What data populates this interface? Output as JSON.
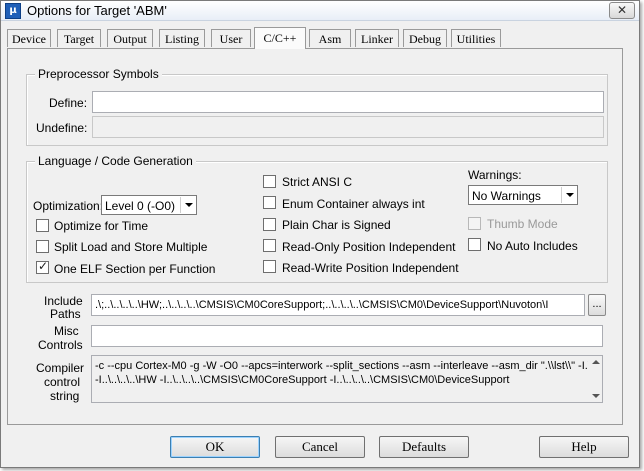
{
  "window": {
    "title": "Options for Target 'ABM'",
    "icon_text": "µ",
    "close_label": "✕"
  },
  "tabs": [
    {
      "label": "Device",
      "active": false
    },
    {
      "label": "Target",
      "active": false
    },
    {
      "label": "Output",
      "active": false
    },
    {
      "label": "Listing",
      "active": false
    },
    {
      "label": "User",
      "active": false
    },
    {
      "label": "C/C++",
      "active": true
    },
    {
      "label": "Asm",
      "active": false
    },
    {
      "label": "Linker",
      "active": false
    },
    {
      "label": "Debug",
      "active": false
    },
    {
      "label": "Utilities",
      "active": false
    }
  ],
  "preprocessor": {
    "title": "Preprocessor Symbols",
    "define_label": "Define:",
    "define_value": "",
    "undefine_label": "Undefine:",
    "undefine_value": ""
  },
  "language": {
    "title": "Language / Code Generation",
    "optimization_label": "Optimization:",
    "optimization_value": "Level 0 (-O0)",
    "optimize_time": {
      "label": "Optimize for Time",
      "checked": false
    },
    "split_load": {
      "label": "Split Load and Store Multiple",
      "checked": false
    },
    "one_elf": {
      "label": "One ELF Section per Function",
      "checked": true
    },
    "strict_ansi": {
      "label": "Strict ANSI C",
      "checked": false
    },
    "enum_container": {
      "label": "Enum Container always int",
      "checked": false
    },
    "plain_char": {
      "label": "Plain Char is Signed",
      "checked": false
    },
    "ro_pi": {
      "label": "Read-Only Position Independent",
      "checked": false
    },
    "rw_pi": {
      "label": "Read-Write Position Independent",
      "checked": false
    },
    "warnings_label": "Warnings:",
    "warnings_value": "No Warnings",
    "thumb_mode": {
      "label": "Thumb Mode",
      "checked": false,
      "disabled": true
    },
    "no_auto_includes": {
      "label": "No Auto Includes",
      "checked": false
    }
  },
  "include_paths": {
    "label_line1": "Include",
    "label_line2": "Paths",
    "value": ".\\;..\\..\\..\\..\\HW;..\\..\\..\\..\\CMSIS\\CM0CoreSupport;..\\..\\..\\..\\CMSIS\\CM0\\DeviceSupport\\Nuvoton\\I",
    "browse_label": "..."
  },
  "misc_controls": {
    "label_line1": "Misc",
    "label_line2": "Controls",
    "value": ""
  },
  "compiler_string": {
    "label_line1": "Compiler",
    "label_line2": "control",
    "label_line3": "string",
    "line1": "-c --cpu Cortex-M0 -g -W -O0 --apcs=interwork --split_sections --asm --interleave --asm_dir \".\\\\lst\\\\\" -I.\\",
    "line2": "-I..\\..\\..\\..\\HW -I..\\..\\..\\..\\CMSIS\\CM0CoreSupport -I..\\..\\..\\..\\CMSIS\\CM0\\DeviceSupport"
  },
  "buttons": {
    "ok": "OK",
    "cancel": "Cancel",
    "defaults": "Defaults",
    "help": "Help"
  }
}
